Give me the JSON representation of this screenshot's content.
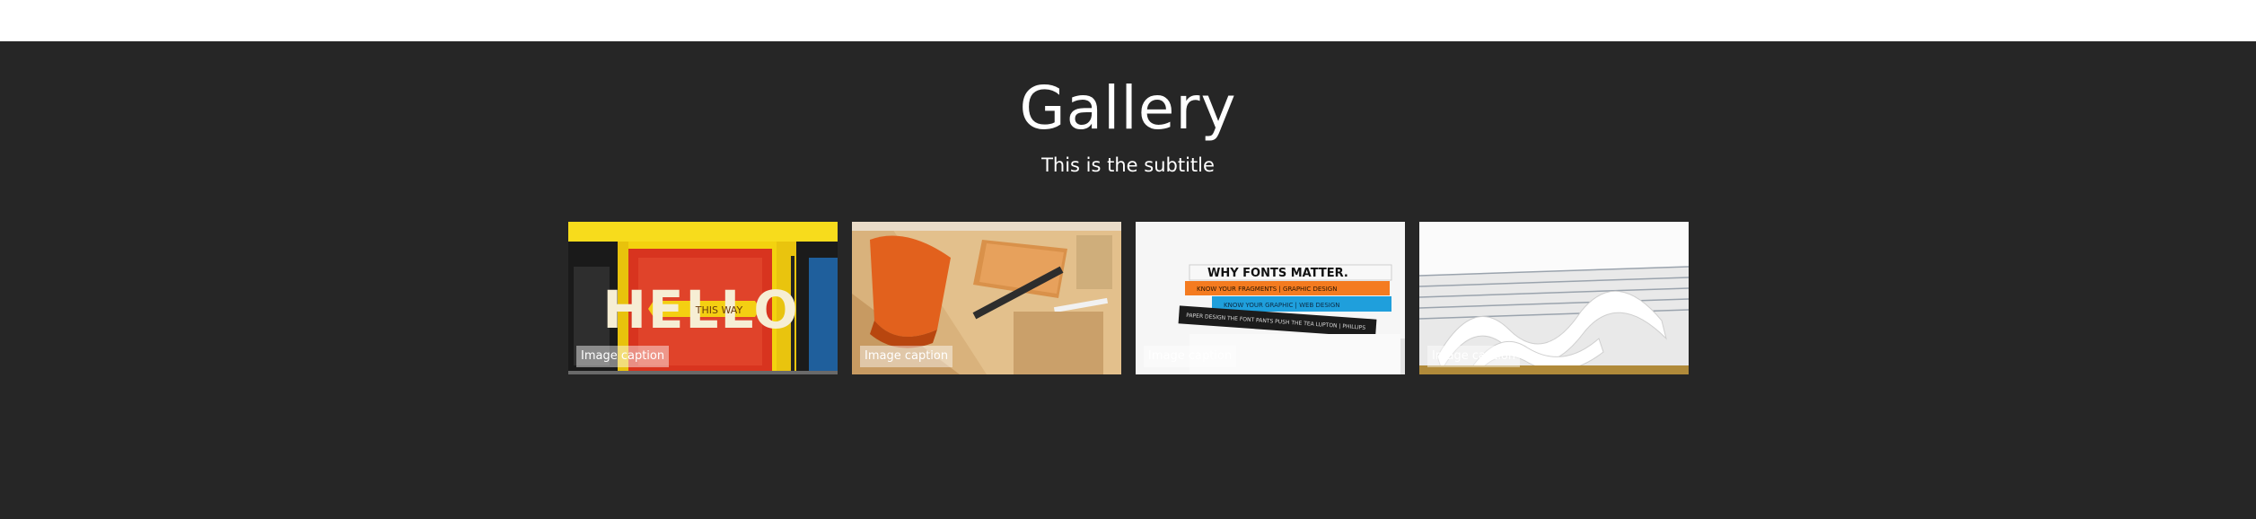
{
  "gallery": {
    "title": "Gallery",
    "subtitle": "This is the subtitle",
    "items": [
      {
        "caption": "Image caption",
        "image": "red-shopfront-hello-sign"
      },
      {
        "caption": "Image caption",
        "image": "wooden-desk-orange-chair"
      },
      {
        "caption": "Image caption",
        "image": "stack-of-design-books"
      },
      {
        "caption": "Image caption",
        "image": "white-wavy-library-shelves"
      }
    ],
    "image_text": {
      "hello": "HELLO",
      "this_way": "THIS WAY",
      "book_1": "WHY FONTS MATTER.",
      "book_2": "KNOW YOUR FRAGMENTS | GRAPHIC DESIGN",
      "book_3": "KNOW YOUR GRAPHIC | WEB DESIGN",
      "book_4": "PAPER DESIGN THE FONT PANTS   PUSH THE TEA   LUPTON | PHILLIPS"
    }
  },
  "colors": {
    "page_background": "#ffffff",
    "section_background": "#262626",
    "text": "#ffffff"
  }
}
